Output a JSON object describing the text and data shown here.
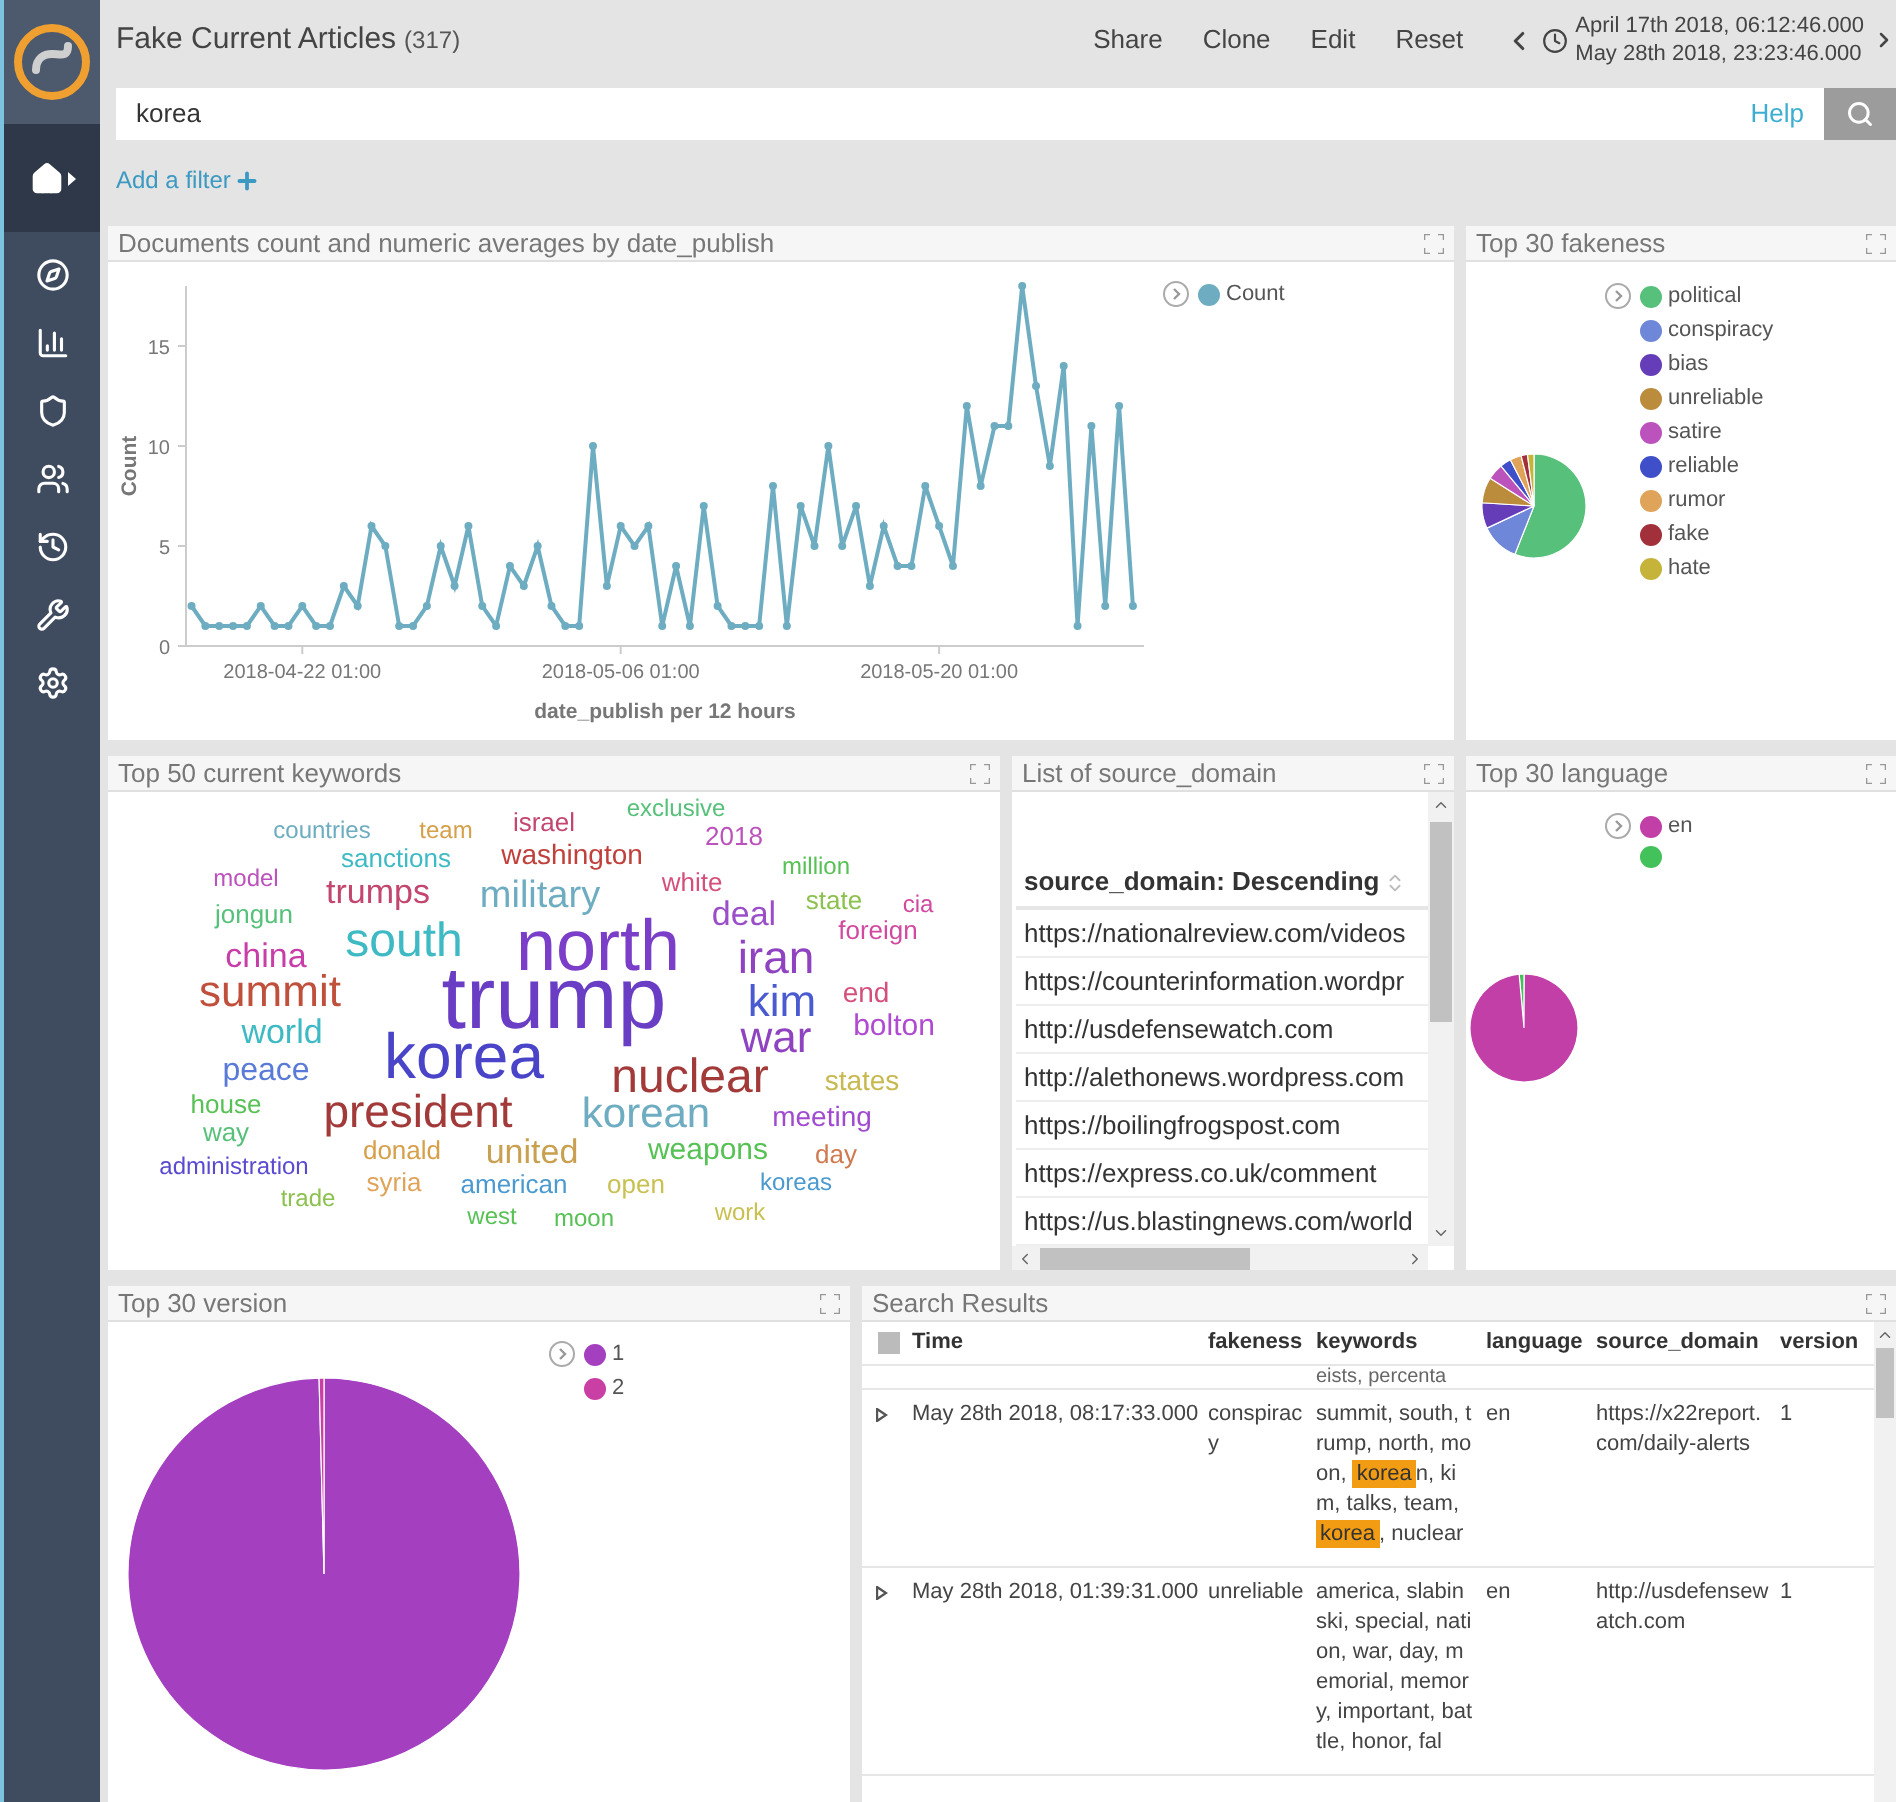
{
  "header": {
    "title": "Fake Current Articles",
    "count": "(317)",
    "actions": [
      "Share",
      "Clone",
      "Edit",
      "Reset"
    ],
    "time_from": "April 17th 2018, 06:12:46.000",
    "time_to": "May 28th 2018, 23:23:46.000"
  },
  "query": {
    "value": "korea",
    "help": "Help"
  },
  "add_filter": "Add a filter",
  "sidebar": {
    "items": [
      {
        "kind": "home",
        "selected": true
      },
      {
        "kind": "discover",
        "selected": false
      },
      {
        "kind": "visualize",
        "selected": false
      },
      {
        "kind": "dashboard",
        "selected": false
      },
      {
        "kind": "users",
        "selected": false
      },
      {
        "kind": "timelion",
        "selected": false
      },
      {
        "kind": "devtools",
        "selected": false
      },
      {
        "kind": "settings",
        "selected": false
      }
    ]
  },
  "line_panel": {
    "title": "Documents count and numeric averages by date_publish",
    "chart_data": {
      "type": "line",
      "xlabel": "date_publish per 12 hours",
      "ylabel": "Count",
      "ylim": [
        0,
        18
      ],
      "yticks": [
        0,
        5,
        10,
        15
      ],
      "categories": [
        null,
        null,
        null,
        null,
        null,
        null,
        null,
        null,
        "2018-04-22 01:00",
        null,
        null,
        null,
        null,
        null,
        null,
        null,
        null,
        null,
        null,
        null,
        null,
        null,
        null,
        null,
        null,
        null,
        null,
        null,
        null,
        null,
        null,
        "2018-05-06 01:00",
        null,
        null,
        null,
        null,
        null,
        null,
        null,
        null,
        null,
        null,
        null,
        null,
        null,
        null,
        null,
        null,
        null,
        null,
        null,
        null,
        null,
        null,
        "2018-05-20 01:00",
        null,
        null,
        null,
        null,
        null,
        null,
        null,
        null,
        null,
        null,
        null,
        null,
        null,
        null
      ],
      "series": [
        {
          "name": "Count",
          "color": "#6eadc1",
          "marker": "circle",
          "values": [
            2,
            1,
            1,
            1,
            1,
            2,
            1,
            1,
            2,
            1,
            1,
            3,
            2,
            6,
            5,
            1,
            1,
            2,
            5,
            3,
            6,
            2,
            1,
            4,
            3,
            5,
            2,
            1,
            1,
            10,
            3,
            6,
            5,
            6,
            1,
            4,
            1,
            7,
            2,
            1,
            1,
            1,
            8,
            1,
            7,
            5,
            10,
            5,
            7,
            3,
            6,
            4,
            4,
            8,
            6,
            4,
            12,
            8,
            11,
            11,
            18,
            13,
            9,
            14,
            1,
            11,
            2,
            12,
            2
          ]
        }
      ]
    }
  },
  "fakeness_panel": {
    "title": "Top 30 fakeness",
    "legend": [
      {
        "label": "political",
        "color": "#57c17b"
      },
      {
        "label": "conspiracy",
        "color": "#6f87d8"
      },
      {
        "label": "bias",
        "color": "#663db8"
      },
      {
        "label": "unreliable",
        "color": "#bc8c3d"
      },
      {
        "label": "satire",
        "color": "#bc52bc"
      },
      {
        "label": "reliable",
        "color": "#3f4fc9"
      },
      {
        "label": "rumor",
        "color": "#e0a35a"
      },
      {
        "label": "fake",
        "color": "#a2303a"
      },
      {
        "label": "hate",
        "color": "#c5b33a"
      }
    ]
  },
  "keywords_panel": {
    "title": "Top 50 current keywords",
    "words": [
      {
        "text": "countries",
        "color": "#6eadc1"
      },
      {
        "text": "team",
        "color": "#d6a04a"
      },
      {
        "text": "israel",
        "color": "#c2466e"
      },
      {
        "text": "exclusive",
        "color": "#57c17b"
      },
      {
        "text": "model",
        "color": "#bc52bc"
      },
      {
        "text": "sanctions",
        "color": "#3ebac4"
      },
      {
        "text": "washington",
        "color": "#c0403c"
      },
      {
        "text": "2018",
        "color": "#bc52bc"
      },
      {
        "text": "jongun",
        "color": "#57c17b"
      },
      {
        "text": "trumps",
        "color": "#c2466e"
      },
      {
        "text": "military",
        "color": "#6eadc1"
      },
      {
        "text": "white",
        "color": "#d4507a"
      },
      {
        "text": "million",
        "color": "#57c155"
      },
      {
        "text": "china",
        "color": "#c83ea8"
      },
      {
        "text": "south",
        "color": "#3ebac4"
      },
      {
        "text": "summit",
        "color": "#c0503c"
      },
      {
        "text": "world",
        "color": "#3ebac4"
      },
      {
        "text": "peace",
        "color": "#5a7ad8"
      },
      {
        "text": "trump",
        "color": "#6a3ec4"
      },
      {
        "text": "korea",
        "color": "#4a45c8"
      },
      {
        "text": "north",
        "color": "#7b3ec8"
      },
      {
        "text": "deal",
        "color": "#9a4fc8"
      },
      {
        "text": "state",
        "color": "#8cc150"
      },
      {
        "text": "cia",
        "color": "#d04aa0"
      },
      {
        "text": "iran",
        "color": "#9043c0"
      },
      {
        "text": "foreign",
        "color": "#d04aa0"
      },
      {
        "text": "kim",
        "color": "#4a5ad0"
      },
      {
        "text": "end",
        "color": "#d4507a"
      },
      {
        "text": "war",
        "color": "#9043c0"
      },
      {
        "text": "bolton",
        "color": "#b04ad0"
      },
      {
        "text": "nuclear",
        "color": "#a33a3a"
      },
      {
        "text": "states",
        "color": "#c8b850"
      },
      {
        "text": "house",
        "color": "#57c155"
      },
      {
        "text": "way",
        "color": "#57c17b"
      },
      {
        "text": "president",
        "color": "#a33a3a"
      },
      {
        "text": "korean",
        "color": "#6eadc1"
      },
      {
        "text": "meeting",
        "color": "#a04ad0"
      },
      {
        "text": "administration",
        "color": "#5a4ad0"
      },
      {
        "text": "donald",
        "color": "#d6a04a"
      },
      {
        "text": "united",
        "color": "#c8a050"
      },
      {
        "text": "weapons",
        "color": "#57c155"
      },
      {
        "text": "day",
        "color": "#d07a50"
      },
      {
        "text": "trade",
        "color": "#8cc150"
      },
      {
        "text": "syria",
        "color": "#e0a35a"
      },
      {
        "text": "american",
        "color": "#4a9ad0"
      },
      {
        "text": "open",
        "color": "#c8c050"
      },
      {
        "text": "koreas",
        "color": "#4a9ad0"
      },
      {
        "text": "west",
        "color": "#57c155"
      },
      {
        "text": "moon",
        "color": "#57c155"
      },
      {
        "text": "work",
        "color": "#c8c050"
      }
    ]
  },
  "source_list": {
    "title": "List of source_domain",
    "column": "source_domain: Descending",
    "rows": [
      "https://nationalreview.com/videos",
      "https://counterinformation.wordpr",
      "http://usdefensewatch.com",
      "http://alethonews.wordpress.com",
      "https://boilingfrogspost.com",
      "https://express.co.uk/comment",
      "https://us.blastingnews.com/world"
    ]
  },
  "language_panel": {
    "title": "Top 30 language",
    "legend": [
      {
        "label": "en",
        "color": "#c13fa6"
      },
      {
        "color": "#43c15a"
      }
    ]
  },
  "version_panel": {
    "title": "Top 30 version",
    "legend": [
      {
        "label": "1",
        "color": "#a43fc0"
      },
      {
        "label": "2",
        "color": "#c93fa4"
      }
    ]
  },
  "search_results": {
    "title": "Search Results",
    "select_all_checked": false,
    "columns": [
      "Time",
      "fakeness",
      "keywords",
      "language",
      "source_domain",
      "version"
    ],
    "partial_row": "eists, percenta",
    "rows": [
      {
        "time": "May 28th 2018, 08:17:33.000",
        "fakeness": "conspiracy",
        "keywords": [
          {
            "text": "summit, south, trump, north, moon, ",
            "highlight": false
          },
          {
            "text": "korea",
            "highlight": true
          },
          {
            "text": "n, kim, talks, team, ",
            "highlight": false
          },
          {
            "text": "korea",
            "highlight": true
          },
          {
            "text": ", nuclear",
            "highlight": false
          }
        ],
        "language": "en",
        "source_domain": "https://x22report.com/daily-alerts",
        "version": "1"
      },
      {
        "time": "May 28th 2018, 01:39:31.000",
        "fakeness": "unreliable",
        "keywords": [
          {
            "text": "america, slabinski, special, nation, war, day, memorial, memory, important, battle, honor, fal",
            "highlight": false
          }
        ],
        "language": "en",
        "source_domain": "http://usdefensewatch.com",
        "version": "1"
      }
    ]
  }
}
